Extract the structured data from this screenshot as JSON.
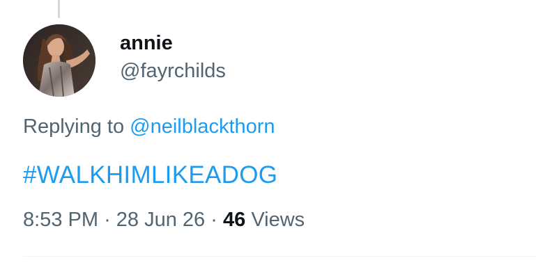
{
  "author": {
    "display_name": "annie",
    "handle": "@fayrchilds"
  },
  "reply": {
    "prefix": "Replying to",
    "mention": "@neilblackthorn"
  },
  "tweet": {
    "text": "#WALKHIMLIKEADOG"
  },
  "meta": {
    "time": "8:53 PM",
    "separator": "·",
    "date": "28 Jun 26",
    "views_count": "46",
    "views_label": "Views"
  },
  "colors": {
    "link": "#1d9bf0",
    "secondary_text": "#536471",
    "primary_text": "#0f1419",
    "thread_line": "#cfd9de"
  }
}
